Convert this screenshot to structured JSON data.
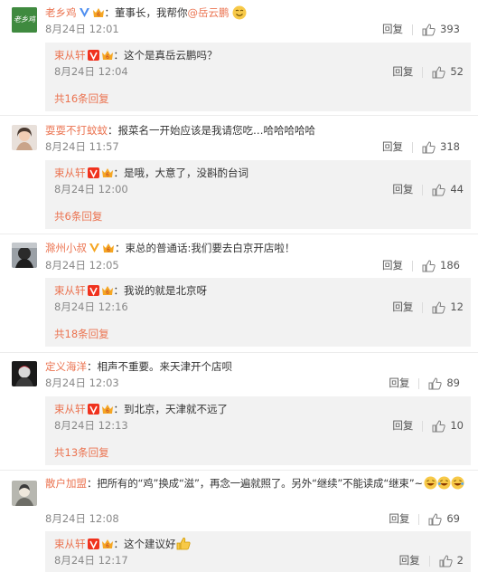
{
  "comments": [
    {
      "user": "老乡鸡",
      "avatar_text": "老乡鸡",
      "text": "：董事长，我帮你",
      "mention": "@岳云鹏",
      "time": "8月24日 12:01",
      "reply_label": "回复",
      "likes": "393",
      "sub": {
        "user": "束从轩",
        "text": "：这个是真岳云鹏吗？",
        "time": "8月24日 12:04",
        "reply_label": "回复",
        "likes": "52",
        "more": "共16条回复"
      }
    },
    {
      "user": "耍耍不打蚊蚊",
      "text": "：报菜名一开始应该是我请您吃…哈哈哈哈哈",
      "time": "8月24日 11:57",
      "reply_label": "回复",
      "likes": "318",
      "sub": {
        "user": "束从轩",
        "text": "：是哦，大意了，没斟酌台词",
        "time": "8月24日 12:00",
        "reply_label": "回复",
        "likes": "44",
        "more": "共6条回复"
      }
    },
    {
      "user": "滁州小叔",
      "text": "：束总的普通话:我们要去白京开店啦！",
      "time": "8月24日 12:05",
      "reply_label": "回复",
      "likes": "186",
      "sub": {
        "user": "束从轩",
        "text": "：我说的就是北京呀",
        "time": "8月24日 12:16",
        "reply_label": "回复",
        "likes": "12",
        "more": "共18条回复"
      }
    },
    {
      "user": "定义海洋",
      "text": "：相声不重要。来天津开个店呗",
      "time": "8月24日 12:03",
      "reply_label": "回复",
      "likes": "89",
      "sub": {
        "user": "束从轩",
        "text": "：到北京，天津就不远了",
        "time": "8月24日 12:13",
        "reply_label": "回复",
        "likes": "10",
        "more": "共13条回复"
      }
    },
    {
      "user": "散户加盟",
      "text": "：把所有的“鸡”换成“滋”，再念一遍就照了。另外“继续”不能读成“继束”~",
      "time": "8月24日 12:08",
      "reply_label": "回复",
      "likes": "69",
      "sub": {
        "user": "束从轩",
        "text": "：这个建议好",
        "time": "8月24日 12:17",
        "reply_label": "回复",
        "likes": "2"
      }
    }
  ],
  "colors": {
    "username": "#eb7350",
    "vip_red": "#f0321e",
    "verify_blue": "#4d8ef0",
    "crown": "#f5a623"
  },
  "icons": [
    "verified-v-icon",
    "vip-crown-icon",
    "like-thumb-icon",
    "smile-emoji",
    "laugh-emoji",
    "thumbs-up-emoji"
  ]
}
